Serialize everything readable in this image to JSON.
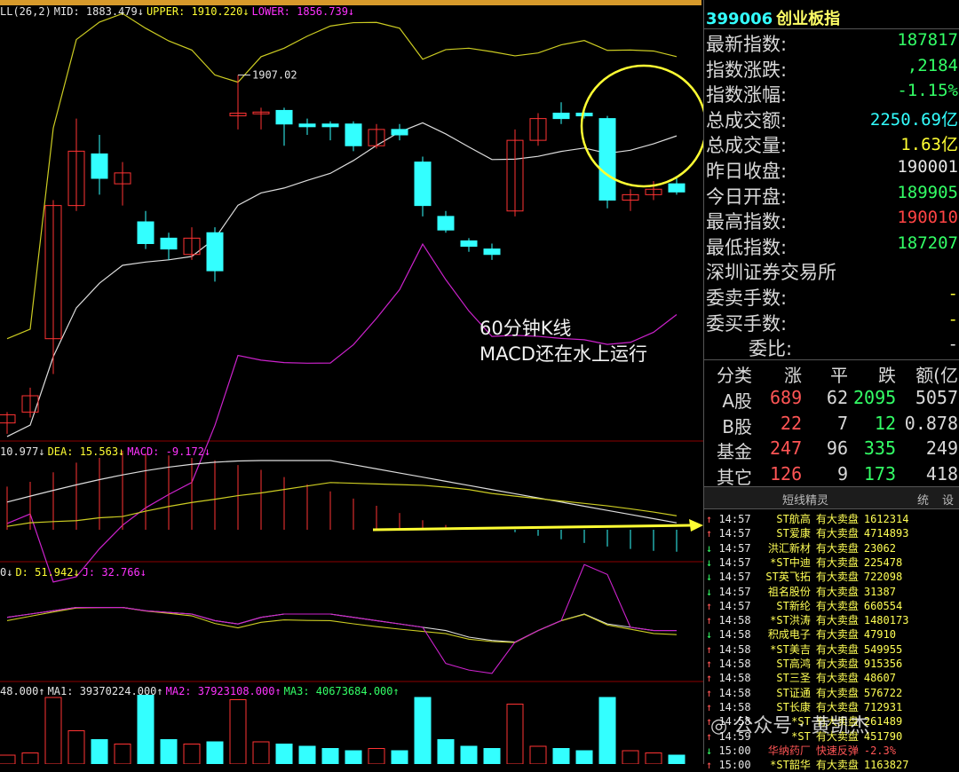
{
  "headers": {
    "boll": [
      {
        "text": "LL(26,2)",
        "color": "white"
      },
      {
        "text": "MID: 1883.479↓",
        "color": "white"
      },
      {
        "text": "UPPER: 1910.220↓",
        "color": "yellow"
      },
      {
        "text": "LOWER: 1856.739↓",
        "color": "magenta"
      }
    ],
    "macd": [
      {
        "text": "10.977↓",
        "color": "white"
      },
      {
        "text": "DEA: 15.563↓",
        "color": "yellow"
      },
      {
        "text": "MACD: -9.172↓",
        "color": "magenta"
      }
    ],
    "kdj": [
      {
        "text": "0↓",
        "color": "white"
      },
      {
        "text": "D: 51.942↓",
        "color": "yellow"
      },
      {
        "text": "J: 32.766↓",
        "color": "magenta"
      }
    ],
    "vol": [
      {
        "text": "48.000↑",
        "color": "white"
      },
      {
        "text": "MA1: 39370224.000↑",
        "color": "white"
      },
      {
        "text": "MA2: 37923108.000↑",
        "color": "magenta"
      },
      {
        "text": "MA3: 40673684.000↑",
        "color": "green"
      }
    ]
  },
  "annotation": {
    "line1": "60分钟K线",
    "line2": "MACD还在水上运行"
  },
  "peak_label": "1907.02",
  "chart_data": {
    "type": "candlestick",
    "title": "",
    "price_ylim": [
      1840,
      1920
    ],
    "candles": [
      {
        "o": 1843.0,
        "h": 1845.0,
        "l": 1841.0,
        "c": 1844.5
      },
      {
        "o": 1845.0,
        "h": 1849.5,
        "l": 1844.0,
        "c": 1848.0
      },
      {
        "o": 1858.5,
        "h": 1884.0,
        "l": 1852.0,
        "c": 1883.0
      },
      {
        "o": 1883.0,
        "h": 1899.0,
        "l": 1882.0,
        "c": 1893.0
      },
      {
        "o": 1892.5,
        "h": 1896.0,
        "l": 1885.0,
        "c": 1888.0
      },
      {
        "o": 1887.0,
        "h": 1891.0,
        "l": 1883.0,
        "c": 1889.0
      },
      {
        "o": 1880.0,
        "h": 1882.0,
        "l": 1875.0,
        "c": 1876.0
      },
      {
        "o": 1877.0,
        "h": 1878.0,
        "l": 1873.0,
        "c": 1875.0
      },
      {
        "o": 1874.0,
        "h": 1879.0,
        "l": 1873.0,
        "c": 1877.0
      },
      {
        "o": 1878.0,
        "h": 1879.0,
        "l": 1869.0,
        "c": 1871.0
      },
      {
        "o": 1899.5,
        "h": 1907.0,
        "l": 1897.0,
        "c": 1900.0
      },
      {
        "o": 1900.0,
        "h": 1901.0,
        "l": 1897.0,
        "c": 1900.2
      },
      {
        "o": 1900.5,
        "h": 1901.0,
        "l": 1894.0,
        "c": 1898.0
      },
      {
        "o": 1898.0,
        "h": 1899.0,
        "l": 1896.0,
        "c": 1897.5
      },
      {
        "o": 1898.0,
        "h": 1898.5,
        "l": 1895.0,
        "c": 1897.5
      },
      {
        "o": 1898.0,
        "h": 1898.5,
        "l": 1893.0,
        "c": 1894.0
      },
      {
        "o": 1894.0,
        "h": 1898.0,
        "l": 1893.5,
        "c": 1897.0
      },
      {
        "o": 1897.0,
        "h": 1898.0,
        "l": 1895.0,
        "c": 1896.0
      },
      {
        "o": 1891.0,
        "h": 1892.0,
        "l": 1881.0,
        "c": 1883.0
      },
      {
        "o": 1881.0,
        "h": 1882.0,
        "l": 1878.0,
        "c": 1878.5
      },
      {
        "o": 1876.5,
        "h": 1877.0,
        "l": 1874.5,
        "c": 1875.5
      },
      {
        "o": 1875.0,
        "h": 1876.0,
        "l": 1873.0,
        "c": 1874.0
      },
      {
        "o": 1882.0,
        "h": 1897.0,
        "l": 1881.0,
        "c": 1895.0
      },
      {
        "o": 1895.0,
        "h": 1900.0,
        "l": 1894.0,
        "c": 1899.0
      },
      {
        "o": 1900.0,
        "h": 1902.0,
        "l": 1898.0,
        "c": 1899.0
      },
      {
        "o": 1900.0,
        "h": 1900.5,
        "l": 1899.0,
        "c": 1899.5
      },
      {
        "o": 1899.0,
        "h": 1899.5,
        "l": 1882.5,
        "c": 1884.0
      },
      {
        "o": 1884.0,
        "h": 1886.0,
        "l": 1882.0,
        "c": 1885.0
      },
      {
        "o": 1885.0,
        "h": 1887.5,
        "l": 1884.0,
        "c": 1886.0
      },
      {
        "o": 1887.0,
        "h": 1888.0,
        "l": 1885.0,
        "c": 1885.5
      }
    ],
    "macd_hist": [
      18,
      20,
      24,
      28,
      30,
      33,
      32,
      31,
      30,
      29,
      27,
      25,
      22,
      19,
      16,
      13,
      10,
      7,
      4,
      2,
      0.5,
      0.3,
      -1,
      -2.5,
      -4,
      -5.5,
      -7,
      -8,
      -8.8,
      -9.17
    ],
    "volume": [
      0.4,
      0.5,
      3.0,
      1.5,
      1.1,
      0.9,
      3.1,
      1.1,
      0.9,
      1.0,
      2.9,
      1.0,
      0.9,
      0.8,
      0.7,
      0.6,
      0.7,
      0.6,
      3.0,
      1.1,
      0.8,
      0.7,
      2.7,
      0.8,
      0.7,
      0.6,
      3.0,
      0.6,
      0.5,
      0.4
    ]
  },
  "quote": {
    "code": "399006",
    "name": "创业板指",
    "rows": [
      {
        "label": "最新指数:",
        "value": "187817",
        "color": "green"
      },
      {
        "label": "指数涨跌:",
        "value": ",2184",
        "color": "green"
      },
      {
        "label": "指数涨幅:",
        "value": "-1.15%",
        "color": "green"
      },
      {
        "label": "总成交额:",
        "value": "2250.69亿",
        "color": "cyan"
      },
      {
        "label": "总成交量:",
        "value": "1.63亿",
        "color": "yellow"
      },
      {
        "label": "昨日收盘:",
        "value": "190001",
        "color": "white"
      },
      {
        "label": "今日开盘:",
        "value": "189905",
        "color": "green"
      },
      {
        "label": "最高指数:",
        "value": "190010",
        "color": "red"
      },
      {
        "label": "最低指数:",
        "value": "187207",
        "color": "green"
      },
      {
        "label": "深圳证券交易所",
        "value": "",
        "color": "white"
      },
      {
        "label": "委卖手数:",
        "value": "-",
        "color": "yellow"
      },
      {
        "label": "委买手数:",
        "value": "-",
        "color": "yellow"
      },
      {
        "label": "委比:",
        "value": "-",
        "color": "white"
      }
    ]
  },
  "breadth": {
    "headers": [
      "分类",
      "涨",
      "平",
      "跌",
      "额(亿"
    ],
    "rows": [
      {
        "cat": "A股",
        "up": "689",
        "flat": "62",
        "down": "2095",
        "amt": "5057"
      },
      {
        "cat": "B股",
        "up": "22",
        "flat": "7",
        "down": "12",
        "amt": "0.878"
      },
      {
        "cat": "基金",
        "up": "247",
        "flat": "96",
        "down": "335",
        "amt": "249"
      },
      {
        "cat": "其它",
        "up": "126",
        "flat": "9",
        "down": "173",
        "amt": "418"
      }
    ]
  },
  "tabs": {
    "main": "短线精灵",
    "t2": "统",
    "t3": "设"
  },
  "signals": [
    {
      "arrow": "↑",
      "time": "14:57",
      "name": "ST航高",
      "action": "有大卖盘",
      "vol": "1612314"
    },
    {
      "arrow": "↑",
      "time": "14:57",
      "name": "ST爱康",
      "action": "有大卖盘",
      "vol": "4714893"
    },
    {
      "arrow": "↓",
      "time": "14:57",
      "name": "洪汇新材",
      "action": "有大卖盘",
      "vol": "23062"
    },
    {
      "arrow": "↓",
      "time": "14:57",
      "name": "*ST中迪",
      "action": "有大卖盘",
      "vol": "225478"
    },
    {
      "arrow": "↓",
      "time": "14:57",
      "name": "ST英飞拓",
      "action": "有大卖盘",
      "vol": "722098"
    },
    {
      "arrow": "↓",
      "time": "14:57",
      "name": "祖名股份",
      "action": "有大卖盘",
      "vol": "31387"
    },
    {
      "arrow": "↑",
      "time": "14:57",
      "name": "ST新纶",
      "action": "有大卖盘",
      "vol": "660554"
    },
    {
      "arrow": "↑",
      "time": "14:58",
      "name": "*ST洪涛",
      "action": "有大卖盘",
      "vol": "1480173"
    },
    {
      "arrow": "↓",
      "time": "14:58",
      "name": "积成电子",
      "action": "有大卖盘",
      "vol": "47910"
    },
    {
      "arrow": "↑",
      "time": "14:58",
      "name": "*ST美吉",
      "action": "有大卖盘",
      "vol": "549955"
    },
    {
      "arrow": "↑",
      "time": "14:58",
      "name": "ST高鸿",
      "action": "有大卖盘",
      "vol": "915356"
    },
    {
      "arrow": "↑",
      "time": "14:58",
      "name": "ST三圣",
      "action": "有大卖盘",
      "vol": "48607"
    },
    {
      "arrow": "↑",
      "time": "14:58",
      "name": "ST证通",
      "action": "有大卖盘",
      "vol": "576722"
    },
    {
      "arrow": "↑",
      "time": "14:58",
      "name": "ST长康",
      "action": "有大卖盘",
      "vol": "712931"
    },
    {
      "arrow": "↑",
      "time": "14:58",
      "name": "*ST",
      "action": "有大卖盘",
      "vol": "261489"
    },
    {
      "arrow": "↑",
      "time": "14:59",
      "name": "*ST",
      "action": "有大卖盘",
      "vol": "451790"
    },
    {
      "arrow": "↓",
      "time": "15:00",
      "name": "华纳药厂",
      "action": "快速反弹",
      "vol": "-2.3%"
    },
    {
      "arrow": "↑",
      "time": "15:00",
      "name": "*ST韶华",
      "action": "有大卖盘",
      "vol": "1163827"
    }
  ],
  "watermark": "公众号 · 黄凯杰",
  "colors": {
    "up": "#ff3333",
    "down": "#33ffff",
    "upper": "#cccc22",
    "mid": "#dddddd",
    "lower": "#cc22cc",
    "highlight": "#ffff33"
  }
}
